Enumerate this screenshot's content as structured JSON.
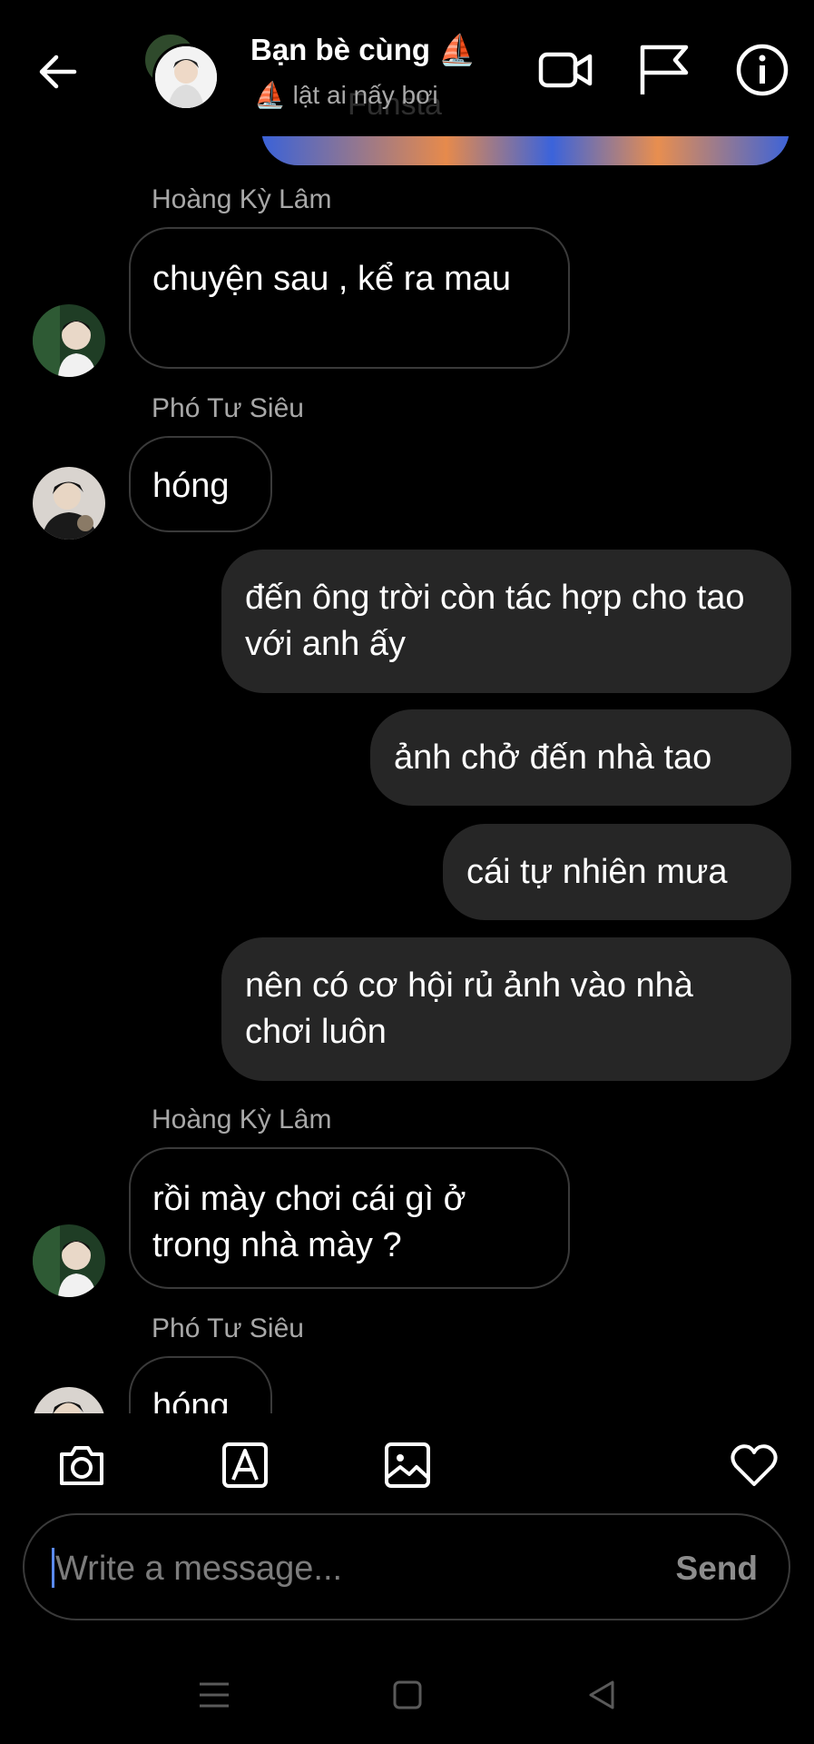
{
  "header": {
    "title": "Bạn bè cùng ⛵",
    "subtitle": "⛵ lật ai nấy bơi",
    "ghost_text": "Funsta",
    "icons": [
      "back-arrow-icon",
      "video-call-icon",
      "flag-icon",
      "info-icon"
    ]
  },
  "messages": [
    {
      "type": "image-partial"
    },
    {
      "type": "sender",
      "name": "Hoàng Kỳ Lâm"
    },
    {
      "type": "in",
      "text": "chuyện sau , kể ra mau"
    },
    {
      "type": "sender",
      "name": "Phó Tư Siêu"
    },
    {
      "type": "in",
      "text": "hóng"
    },
    {
      "type": "out",
      "text": "đến ông trời còn tác hợp cho tao với anh ấy"
    },
    {
      "type": "out",
      "text": "ảnh chở  đến nhà tao"
    },
    {
      "type": "out",
      "text": "cái tự nhiên mưa"
    },
    {
      "type": "out",
      "text": "nên có cơ hội rủ ảnh vào nhà chơi luôn"
    },
    {
      "type": "sender",
      "name": "Hoàng Kỳ Lâm"
    },
    {
      "type": "in",
      "text": "rồi mày chơi cái gì ở trong nhà mày ?"
    },
    {
      "type": "sender",
      "name": "Phó Tư Siêu"
    },
    {
      "type": "in",
      "text": "hóng"
    }
  ],
  "m": {
    "s1": "Hoàng Kỳ Lâm",
    "b1": "chuyện sau , kể ra mau",
    "s2": "Phó Tư Siêu",
    "b2": "hóng",
    "o1": "đến ông trời còn tác hợp cho tao với anh ấy",
    "o2": "ảnh chở  đến nhà tao",
    "o3": "cái tự nhiên mưa",
    "o4": "nên có cơ hội rủ ảnh vào nhà chơi luôn",
    "s3": "Hoàng Kỳ Lâm",
    "b3": "rồi mày chơi cái gì ở trong nhà mày ?",
    "s4": "Phó Tư Siêu",
    "b4": "hóng"
  },
  "composer": {
    "placeholder": "Write a message...",
    "send_label": "Send",
    "toolbar_icons": [
      "camera-icon",
      "text-style-icon",
      "gallery-icon",
      "heart-icon"
    ]
  },
  "colors": {
    "background": "#000000",
    "outgoing_bubble": "#262626",
    "incoming_border": "#3a3a3a",
    "muted_text": "#a8a8a8"
  }
}
